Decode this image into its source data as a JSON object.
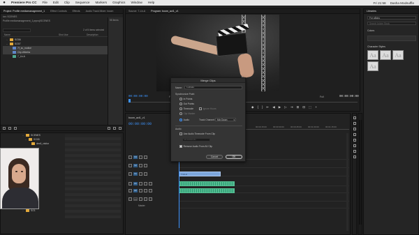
{
  "menubar": {
    "apple": "",
    "items": [
      "Premiere Pro CC",
      "File",
      "Edit",
      "Clip",
      "Sequence",
      "Markers",
      "Graphics",
      "Window",
      "Help"
    ],
    "clock": "Fri 21:58",
    "user": "Dasha Modsuffle"
  },
  "project": {
    "tabs": [
      "Project: Profile mediamanagement_1",
      "Effect Controls",
      "Effects",
      "Audio Track Mixer: boom"
    ],
    "path": "Profile mediamanagement_1.prproj\\SCENES",
    "title_short": "ion: SCENES",
    "items_count": "55 Items",
    "search_placeholder": "",
    "selected_count": "2 of 5 items selected",
    "columns": [
      "Name",
      "Shot Use",
      "Description"
    ],
    "rows": [
      {
        "type": "folder",
        "name": "SO06",
        "chev": "›",
        "sel": false
      },
      {
        "type": "folder",
        "name": "SO07",
        "chev": "⌄",
        "sel": false
      },
      {
        "type": "clip",
        "name": "7f_sc_nodice",
        "sel": true,
        "color": "blue"
      },
      {
        "type": "clip",
        "name": "Clip #Merita",
        "sel": true,
        "color": "blue"
      },
      {
        "type": "clip",
        "name": "7_Lb-A",
        "sel": false,
        "color": "green"
      }
    ]
  },
  "media": {
    "rows": [
      {
        "name": "SCENES",
        "chev": "⌄"
      },
      {
        "name": "SO05",
        "chev": "⌄"
      },
      {
        "name": "dec6_visitor",
        "chev": ""
      },
      {
        "name": "SO07",
        "chev": "›"
      },
      {
        "name": "SO1",
        "chev": "›"
      }
    ]
  },
  "monitor": {
    "tabs": [
      "Source: 7-Lb-A",
      "Program: boom_act1_v1"
    ],
    "tc_left": "00:00:00:00",
    "tc_right": "00:00:00:00",
    "fit": "Fit",
    "full": "Full",
    "transport": [
      "◆",
      "{",
      "}",
      "⇤",
      "◀",
      "▶",
      "▷",
      "⇥",
      "⊞",
      "⊟",
      "⬚",
      "+"
    ]
  },
  "dialog": {
    "title": "Merge Clips",
    "name_label": "Name:",
    "name_value": "7-Lb-A1",
    "sync_label": "Synchronize Point",
    "sync_options": [
      {
        "label": "In Points",
        "on": false,
        "dim": false
      },
      {
        "label": "Out Points",
        "on": false,
        "dim": false
      },
      {
        "label": "Timecode",
        "on": false,
        "dim": false
      },
      {
        "label": "Clip Marker",
        "on": false,
        "dim": true
      },
      {
        "label": "Audio",
        "on": true,
        "dim": false
      }
    ],
    "ignore_hours": "Ignore Hours",
    "track_channel_label": "Track Channel:",
    "track_channel_value": "Mix Down",
    "audio_label": "Audio",
    "use_audio_tc": "Use Audio Timecode From Clip",
    "audio_tc_value": "00:00:00:00",
    "remove_audio": "Remove Audio From AV Clip",
    "cancel": "Cancel",
    "ok": "OK"
  },
  "libraries": {
    "tab": "Libraries",
    "selected_lib": "For aBcks",
    "search_placeholder": "Search Adobe Stock",
    "colors_label": "Colors",
    "styles_label": "Character Styles",
    "tiles": [
      "Aa",
      "Aa",
      "Aa",
      "Aa"
    ]
  },
  "timeline": {
    "sequence": "boom_act1_v1",
    "timecode": "00:00:00:00",
    "ruler": [
      "00:00",
      "00:00:15:00",
      "00:00:30:00",
      "00:00:45:00",
      "00:01:00:00",
      "00:01:15:00"
    ],
    "tracks": [
      {
        "name": "V3",
        "clip": ""
      },
      {
        "name": "V2",
        "clip": ""
      },
      {
        "name": "V1",
        "clip": "7-Lb-A"
      },
      {
        "name": "A1",
        "clip": "audio"
      },
      {
        "name": "A2",
        "clip": "audio"
      },
      {
        "name": "A3",
        "clip": ""
      },
      {
        "name": "Master",
        "clip": ""
      }
    ]
  }
}
